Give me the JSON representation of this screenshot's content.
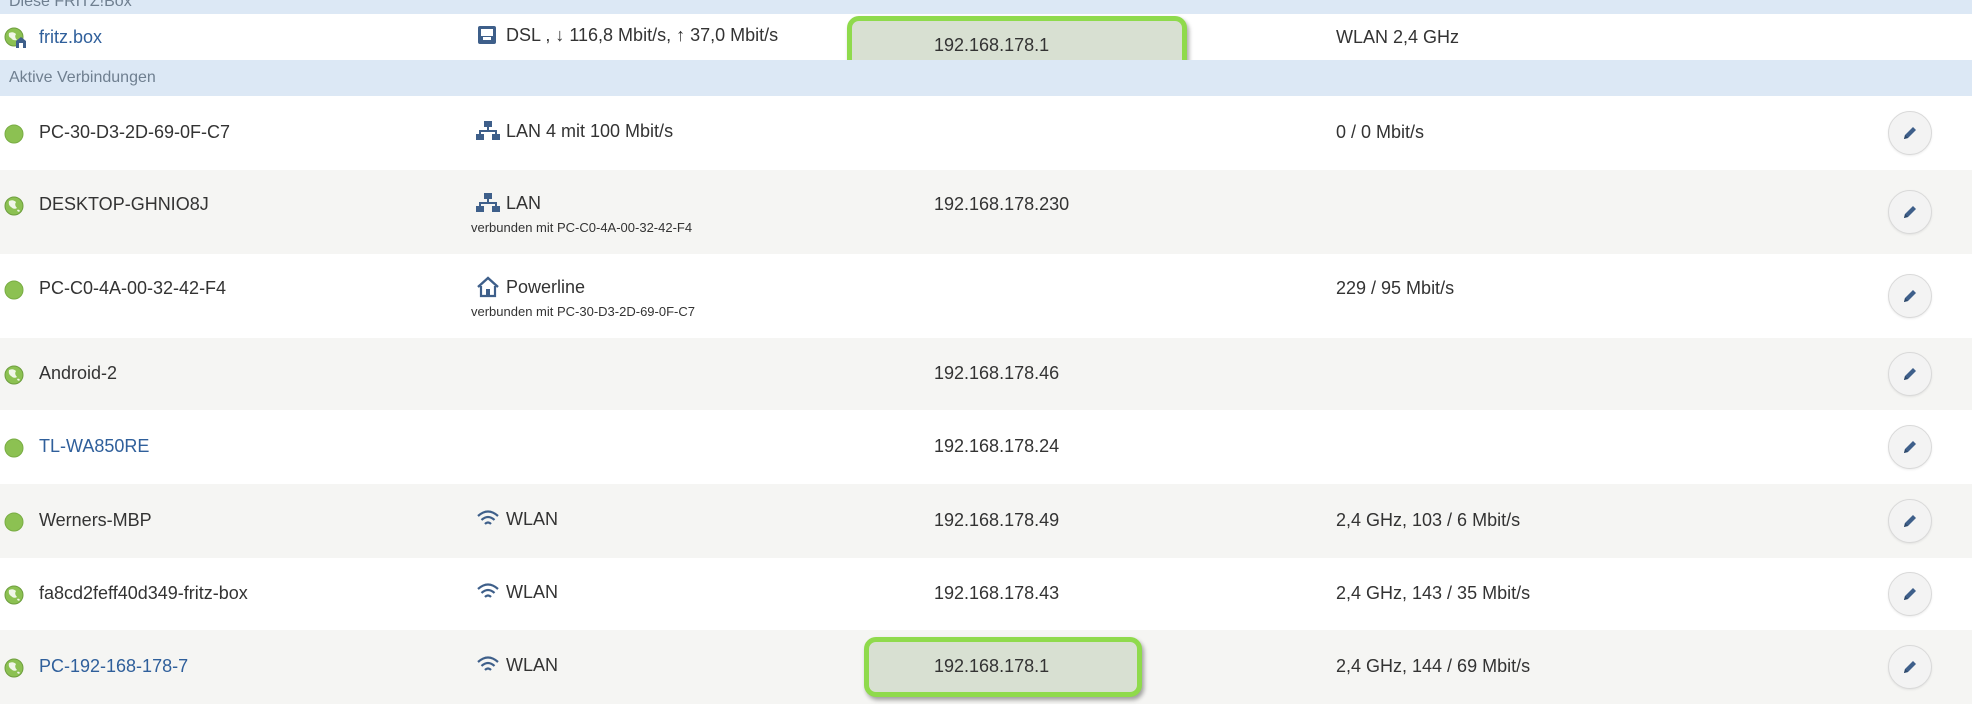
{
  "sections": {
    "this_box": "Diese FRITZ!Box",
    "active": "Aktive Verbindungen"
  },
  "fritzbox": {
    "name": "fritz.box",
    "connection": "DSL , ↓ 116,8 Mbit/s, ↑ 37,0 Mbit/s",
    "ip": "192.168.178.1",
    "property": "WLAN 2,4 GHz",
    "status_icon": "globe-home-icon",
    "connection_icon": "dsl-modem-icon"
  },
  "devices": [
    {
      "name": "PC-30-D3-2D-69-0F-C7",
      "link": false,
      "status_icon": "green-dot-icon",
      "connection": "LAN 4 mit 100 Mbit/s",
      "connection_icon": "lan-network-icon",
      "sub": "",
      "ip": "",
      "property": "0 / 0 Mbit/s"
    },
    {
      "name": "DESKTOP-GHNIO8J",
      "link": false,
      "status_icon": "globe-icon",
      "connection": "LAN",
      "connection_icon": "lan-network-icon",
      "sub": "verbunden mit PC-C0-4A-00-32-42-F4",
      "ip": "192.168.178.230",
      "property": ""
    },
    {
      "name": "PC-C0-4A-00-32-42-F4",
      "link": false,
      "status_icon": "green-dot-icon",
      "connection": "Powerline",
      "connection_icon": "powerline-house-icon",
      "sub": "verbunden mit PC-30-D3-2D-69-0F-C7",
      "ip": "",
      "property": "229 / 95 Mbit/s"
    },
    {
      "name": "Android-2",
      "link": false,
      "status_icon": "globe-icon",
      "connection": "",
      "connection_icon": "",
      "sub": "",
      "ip": "192.168.178.46",
      "property": ""
    },
    {
      "name": "TL-WA850RE",
      "link": true,
      "status_icon": "green-dot-icon",
      "connection": "",
      "connection_icon": "",
      "sub": "",
      "ip": "192.168.178.24",
      "property": ""
    },
    {
      "name": "Werners-MBP",
      "link": false,
      "status_icon": "green-dot-icon",
      "connection": "WLAN",
      "connection_icon": "wifi-icon",
      "sub": "",
      "ip": "192.168.178.49",
      "property": "2,4 GHz, 103 / 6 Mbit/s"
    },
    {
      "name": "fa8cd2feff40d349-fritz-box",
      "link": false,
      "status_icon": "globe-icon",
      "connection": "WLAN",
      "connection_icon": "wifi-icon",
      "sub": "",
      "ip": "192.168.178.43",
      "property": "2,4 GHz, 143 / 35 Mbit/s"
    },
    {
      "name": "PC-192-168-178-7",
      "link": true,
      "status_icon": "globe-icon",
      "connection": "WLAN",
      "connection_icon": "wifi-icon",
      "sub": "",
      "ip": "192.168.178.1",
      "property": "2,4 GHz, 144 / 69 Mbit/s"
    }
  ],
  "colors": {
    "section_bg": "#dce8f5",
    "row_alt_bg": "#f5f5f3",
    "link": "#2f5f9b",
    "status_green": "#8cc152",
    "highlight_border": "#8fda4c",
    "icon_blue": "#3e5f8a"
  }
}
